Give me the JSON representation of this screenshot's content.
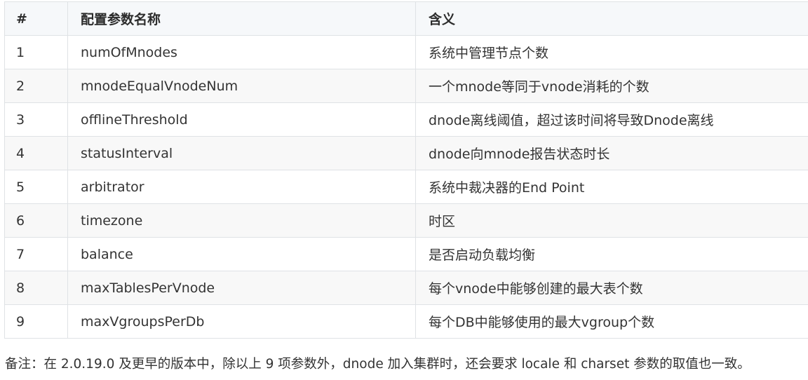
{
  "table": {
    "headers": [
      "#",
      "配置参数名称",
      "含义"
    ],
    "rows": [
      {
        "num": "1",
        "name": "numOfMnodes",
        "desc": "系统中管理节点个数"
      },
      {
        "num": "2",
        "name": "mnodeEqualVnodeNum",
        "desc": "一个mnode等同于vnode消耗的个数"
      },
      {
        "num": "3",
        "name": "offlineThreshold",
        "desc": "dnode离线阈值，超过该时间将导致Dnode离线"
      },
      {
        "num": "4",
        "name": "statusInterval",
        "desc": "dnode向mnode报告状态时长"
      },
      {
        "num": "5",
        "name": "arbitrator",
        "desc": "系统中裁决器的End Point"
      },
      {
        "num": "6",
        "name": "timezone",
        "desc": "时区"
      },
      {
        "num": "7",
        "name": "balance",
        "desc": "是否启动负载均衡"
      },
      {
        "num": "8",
        "name": "maxTablesPerVnode",
        "desc": "每个vnode中能够创建的最大表个数"
      },
      {
        "num": "9",
        "name": "maxVgroupsPerDb",
        "desc": "每个DB中能够使用的最大vgroup个数"
      }
    ]
  },
  "note": "备注：在 2.0.19.0 及更早的版本中，除以上 9 项参数外，dnode 加入集群时，还会要求 locale 和 charset 参数的取值也一致。"
}
